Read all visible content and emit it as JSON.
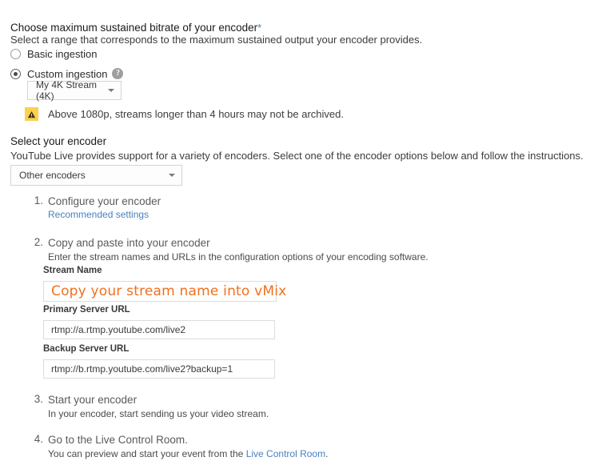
{
  "bitrate_section": {
    "title": "Choose maximum sustained bitrate of your encoder",
    "required_marker": "*",
    "subtitle": "Select a range that corresponds to the maximum sustained output your encoder provides.",
    "options": [
      {
        "label": "Basic ingestion",
        "selected": false
      },
      {
        "label": "Custom ingestion",
        "selected": true
      }
    ],
    "help_icon_glyph": "?",
    "stream_dropdown": {
      "value": "My 4K Stream (4K)",
      "caret_icon": "chevron-down-icon"
    },
    "warning": {
      "icon": "warning-triangle-icon",
      "text": "Above 1080p, streams longer than 4 hours may not be archived.",
      "icon_bg_color": "#fbd14b"
    }
  },
  "encoder_section": {
    "title": "Select your encoder",
    "subtitle": "YouTube Live provides support for a variety of encoders. Select one of the encoder options below and follow the instructions.",
    "encoder_dropdown": {
      "value": "Other encoders",
      "caret_icon": "chevron-down-icon"
    }
  },
  "steps": [
    {
      "number": "1.",
      "title": "Configure your encoder",
      "link_text": "Recommended settings"
    },
    {
      "number": "2.",
      "title": "Copy and paste into your encoder",
      "description": "Enter the stream names and URLs in the configuration options of your encoding software."
    },
    {
      "number": "3.",
      "title": "Start your encoder",
      "description": "In your encoder, start sending us your video stream."
    },
    {
      "number": "4.",
      "title": "Go to the Live Control Room.",
      "description_prefix": "You can preview and start your event from the ",
      "link_text": "Live Control Room",
      "description_suffix": "."
    }
  ],
  "fields": [
    {
      "label": "Stream Name",
      "annotation": "Copy your stream name into vMix",
      "annotation_color": "#f07020",
      "value": ""
    },
    {
      "label": "Primary Server URL",
      "value": "rtmp://a.rtmp.youtube.com/live2"
    },
    {
      "label": "Backup Server URL",
      "value": "rtmp://b.rtmp.youtube.com/live2?backup=1"
    }
  ]
}
